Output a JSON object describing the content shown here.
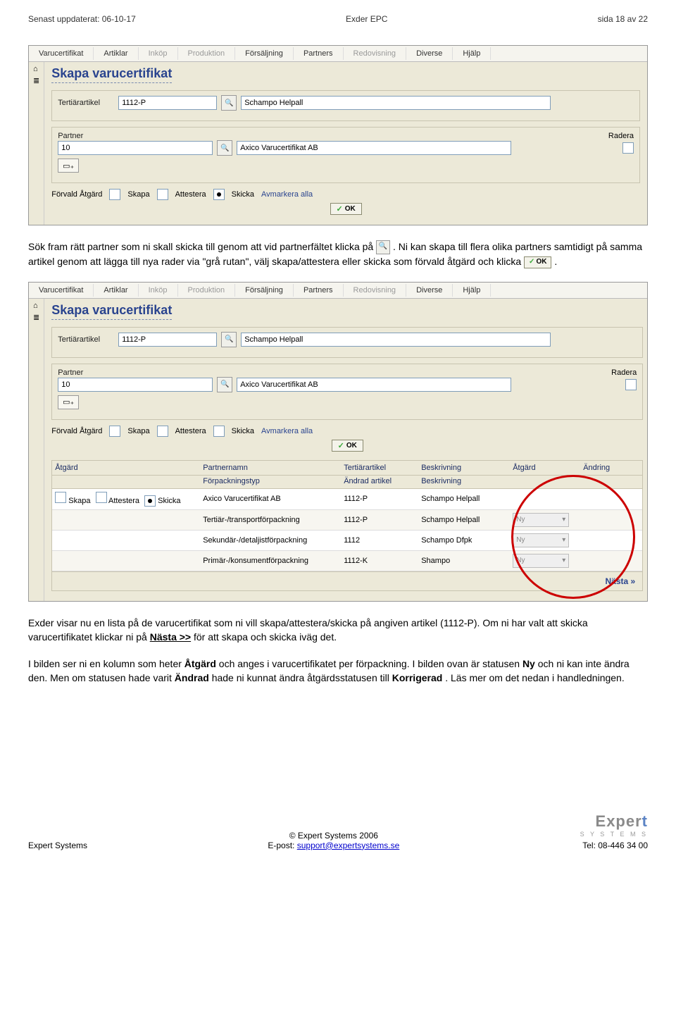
{
  "header": {
    "left": "Senast uppdaterat: 06-10-17",
    "center": "Exder EPC",
    "right": "sida 18 av 22"
  },
  "menu": {
    "items": [
      "Varucertifikat",
      "Artiklar",
      "Inköp",
      "Produktion",
      "Försäljning",
      "Partners",
      "Redovisning",
      "Diverse",
      "Hjälp"
    ],
    "disabled": [
      "Inköp",
      "Produktion",
      "Redovisning"
    ]
  },
  "form": {
    "title": "Skapa varucertifikat",
    "tertiar_label": "Tertiärartikel",
    "tertiar_value": "1112-P",
    "tertiar_desc": "Schampo Helpall",
    "partner_label": "Partner",
    "partner_value": "10",
    "partner_desc": "Axico Varucertifikat AB",
    "radera_label": "Radera",
    "forvald_label": "Förvald Åtgärd",
    "skapa": "Skapa",
    "attestera": "Attestera",
    "skicka": "Skicka",
    "avmarkera": "Avmarkera alla",
    "ok": "OK"
  },
  "paragraph1": {
    "t1": "Sök fram rätt partner som ni skall skicka till genom att vid partnerfältet klicka på ",
    "t2": ". Ni kan skapa till flera olika partners samtidigt på samma artikel genom att lägga till nya rader via \"grå rutan\", välj skapa/attestera eller skicka som förvald åtgärd och klicka ",
    "t3": "."
  },
  "table": {
    "head": {
      "atgard": "Åtgärd",
      "partnernamn": "Partnernamn",
      "forpackningstyp": "Förpackningstyp",
      "tertiarartikel": "Tertiärartikel",
      "andrad_artikel": "Ändrad artikel",
      "beskrivning": "Beskrivning",
      "atgard2": "Åtgärd",
      "andring": "Ändring"
    },
    "rows": [
      {
        "forpack": "",
        "partner": "Axico Varucertifikat AB",
        "art": "1112-P",
        "beskr": "Schampo Helpall",
        "sel": ""
      },
      {
        "forpack": "Tertiär-/transportförpackning",
        "partner": "",
        "art": "1112-P",
        "beskr": "Schampo Helpall",
        "sel": "Ny"
      },
      {
        "forpack": "Sekundär-/detaljistförpackning",
        "partner": "",
        "art": "1112",
        "beskr": "Schampo Dfpk",
        "sel": "Ny"
      },
      {
        "forpack": "Primär-/konsumentförpackning",
        "partner": "",
        "art": "1112-K",
        "beskr": "Shampo",
        "sel": "Ny"
      }
    ],
    "nasta": "Nästa »"
  },
  "paragraph2": {
    "t1": "Exder visar nu en lista på de varucertifikat som ni vill skapa/attestera/skicka på angiven artikel (1112-P). Om ni har valt att skicka varucertifikatet klickar ni på ",
    "nasta": "Nästa >>",
    "t2": " för att skapa och skicka iväg det.",
    "t3": "I bilden ser ni en kolumn som heter ",
    "b1": "Åtgärd",
    "t4": " och anges i varucertifikatet per förpackning. I bilden ovan är statusen ",
    "b2": "Ny",
    "t5": " och ni kan inte ändra den. Men om statusen hade varit ",
    "b3": "Ändrad",
    "t6": " hade ni kunnat ändra åtgärdsstatusen till ",
    "b4": "Korrigerad",
    "t7": ". Läs mer om det nedan i handledningen."
  },
  "footer": {
    "left": "Expert Systems",
    "copyright": "© Expert Systems 2006",
    "email_label": "E-post: ",
    "email": "support@expertsystems.se",
    "tel": "Tel: 08-446 34 00",
    "logo1": "Exper",
    "logo2": "t",
    "logo_sub": "S Y S T E M S"
  }
}
